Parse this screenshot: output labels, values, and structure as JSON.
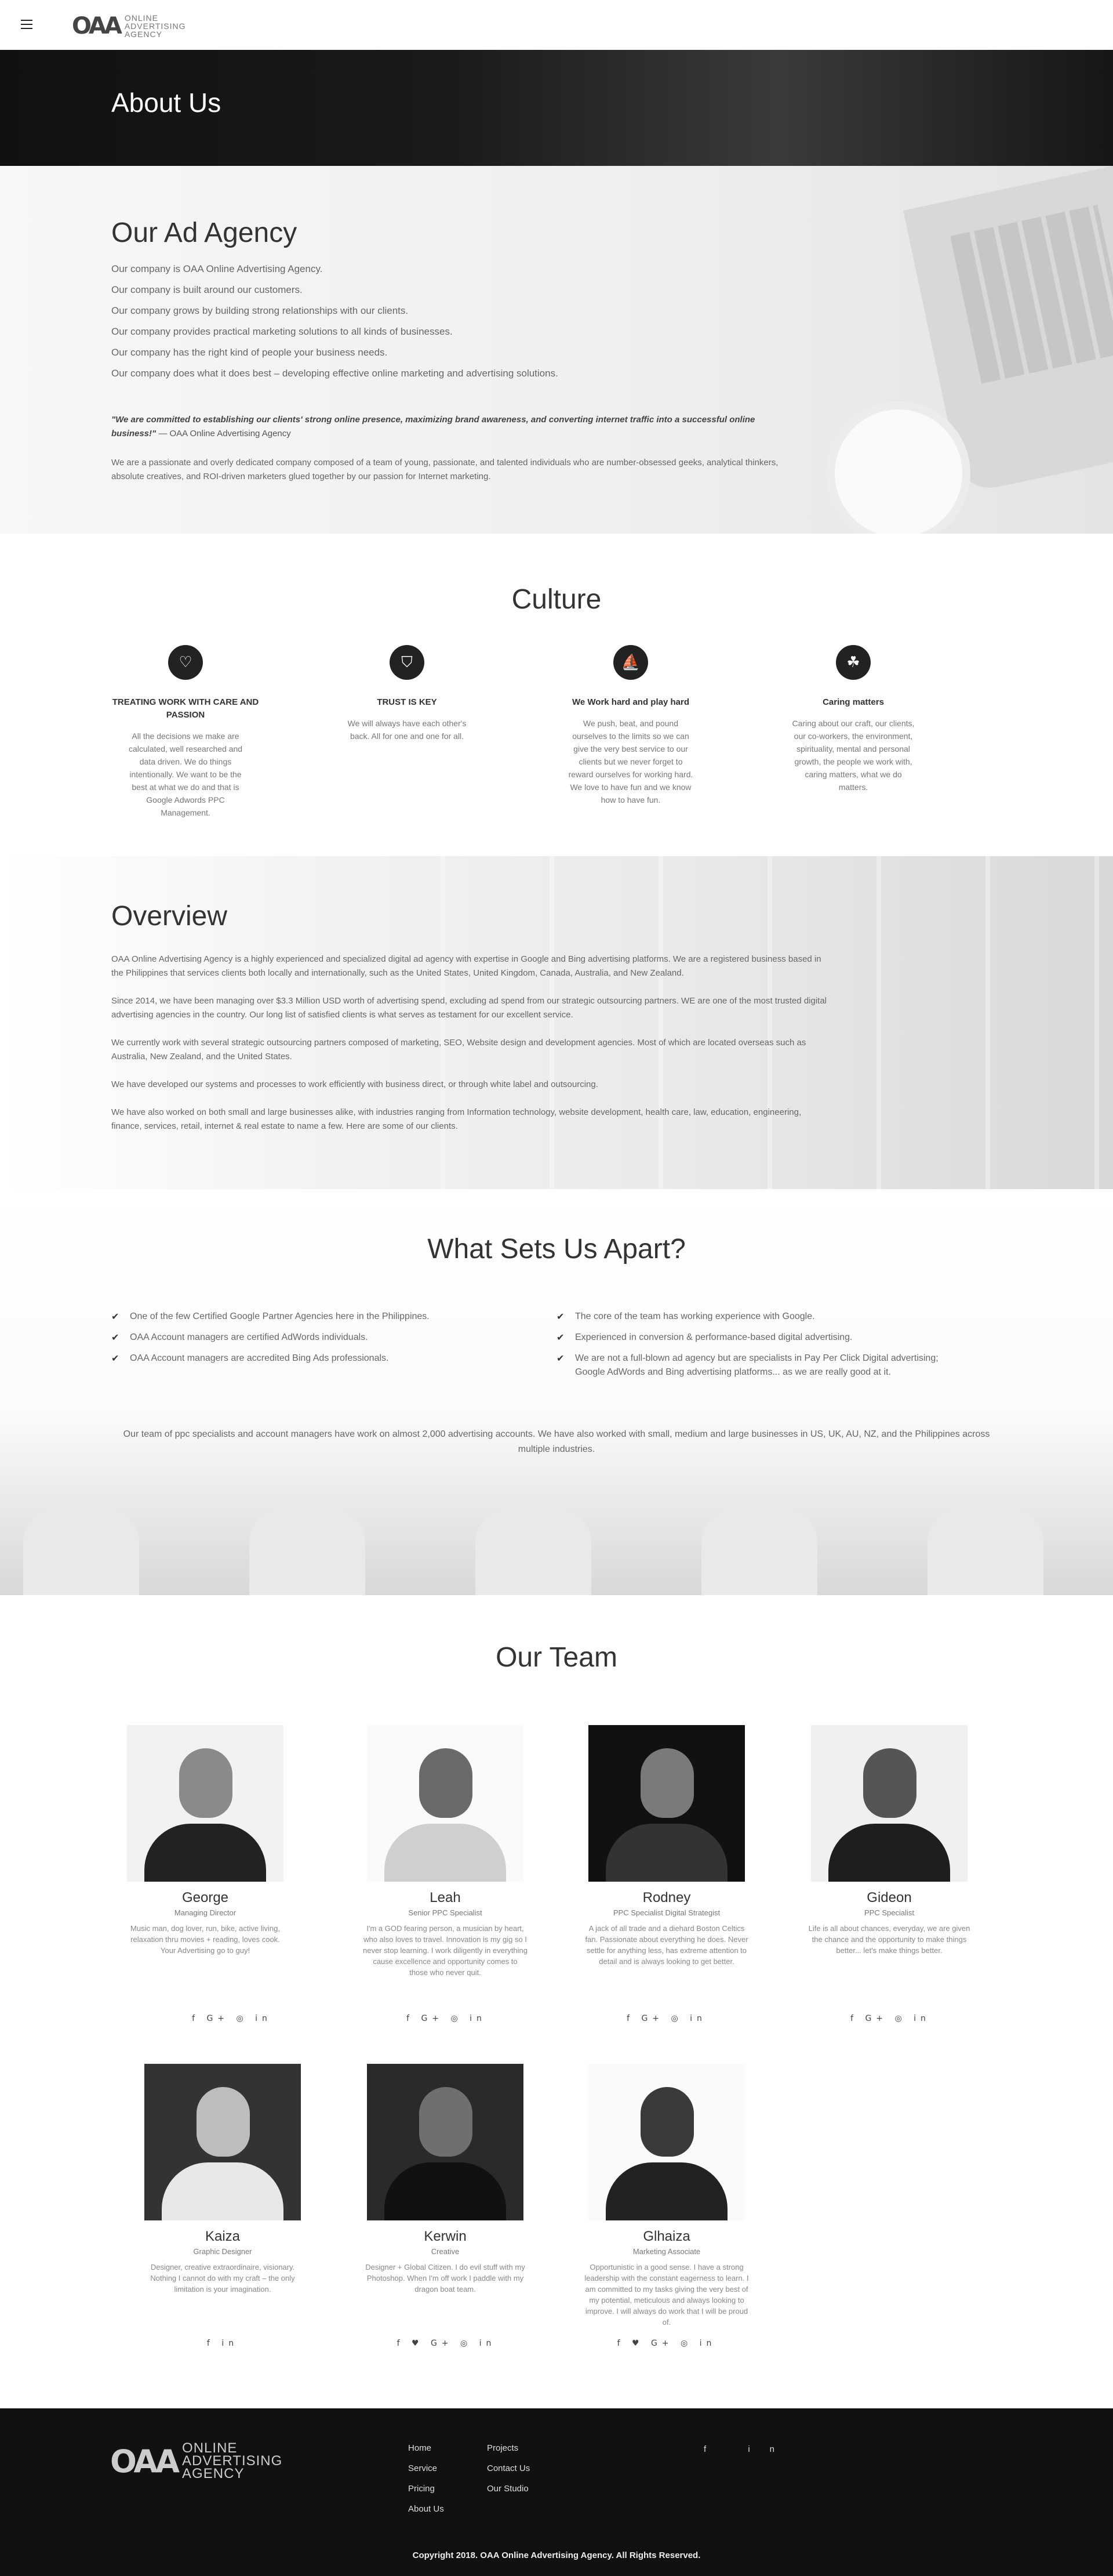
{
  "header": {
    "logo_mark": "OAA",
    "logo_line1": "ONLINE",
    "logo_line2": "ADVERTISING",
    "logo_line3": "AGENCY",
    "menu_icon": "hamburger-icon"
  },
  "hero": {
    "title": "About Us"
  },
  "agency": {
    "title": "Our Ad Agency",
    "lines": [
      "Our company is OAA Online Advertising Agency.",
      "Our company is built around our customers.",
      "Our company grows by building strong relationships with our clients.",
      "Our company provides practical marketing solutions to all kinds of businesses.",
      "Our company has the right kind of people your business needs.",
      "Our company does what it does best – developing effective online marketing and advertising solutions."
    ],
    "quote": "\"We are committed to establishing our clients' strong online presence, maximizing brand awareness, and converting internet traffic into a successful online business!\"",
    "quote_author": "— OAA Online Advertising Agency",
    "paragraph": "We are a passionate and overly dedicated company composed of a team of young, passionate, and talented individuals who are number-obsessed geeks, analytical thinkers, absolute creatives, and ROI-driven marketers glued together by our passion for Internet marketing."
  },
  "culture": {
    "title": "Culture",
    "items": [
      {
        "icon": "heart-icon",
        "title": "TREATING WORK WITH CARE AND PASSION",
        "text": "All the decisions we make are calculated, well researched and data driven. We do things intentionally. We want to be the best at what we do and that is Google Adwords PPC Management."
      },
      {
        "icon": "shield-icon",
        "title": "TRUST IS KEY",
        "text": "We will always have each other's back. All for one and one for all."
      },
      {
        "icon": "boat-icon",
        "title": "We Work hard and play hard",
        "text": "We push, beat, and pound ourselves to the limits so we can give the very best service to our clients but we never forget to reward ourselves for working hard. We love to have fun and we know how to have fun."
      },
      {
        "icon": "handshake-icon",
        "title": "Caring matters",
        "text": "Caring about our craft, our clients, our co-workers, the environment, spirituality, mental and personal growth, the people we work with, caring matters, what we do matters."
      }
    ]
  },
  "overview": {
    "title": "Overview",
    "paragraphs": [
      "OAA Online Advertising Agency is a highly experienced and specialized digital ad agency with expertise in Google and Bing advertising platforms. We are a registered business based in the Philippines that services clients both locally and internationally, such as the United States, United Kingdom, Canada, Australia, and New Zealand.",
      "Since 2014, we have been managing over $3.3 Million USD worth of advertising spend, excluding ad spend from our strategic outsourcing partners. WE are one of the most trusted digital advertising agencies in the country. Our long list of satisfied clients is what serves as testament for our excellent service.",
      "We currently work with several strategic outsourcing partners composed of marketing, SEO, Website design and development agencies. Most of which are located overseas such as Australia, New Zealand, and the United States.",
      "We have developed our systems and processes to work efficiently with business direct, or through white label and outsourcing.",
      "We have also worked on both small and large businesses alike, with industries ranging from Information technology, website development, health care, law, education, engineering, finance, services, retail, internet & real estate to name a few. Here are some of our clients."
    ]
  },
  "apart": {
    "title": "What Sets Us Apart?",
    "left": [
      "One of the few Certified Google Partner Agencies here in the Philippines.",
      "OAA Account managers are certified AdWords individuals.",
      "OAA Account managers are accredited Bing Ads professionals."
    ],
    "right": [
      "The core of the team has working experience with Google.",
      "Experienced in conversion & performance-based digital advertising.",
      "We are not a full-blown ad agency but are specialists in Pay Per Click Digital advertising; Google AdWords and Bing advertising platforms... as we are really good at it."
    ],
    "paragraph": "Our team of ppc specialists and account managers have work on almost 2,000 advertising accounts. We have also worked with small, medium and large businesses in US, UK, AU, NZ, and the Philippines across multiple industries."
  },
  "team": {
    "title": "Our Team",
    "members": [
      {
        "name": "George",
        "role": "Managing Director",
        "bio": "Music man, dog lover, run, bike, active living, relaxation thru movies + reading, loves cook. Your Advertising go to guy!",
        "socials": "f G+ ◎ in"
      },
      {
        "name": "Leah",
        "role": "Senior PPC Specialist",
        "bio": "I'm a GOD fearing person, a musician by heart, who also loves to travel. Innovation is my gig so I never stop learning. I work diligently in everything cause excellence and opportunity comes to those who never quit.",
        "socials": "f G+ ◎ in"
      },
      {
        "name": "Rodney",
        "role": "PPC Specialist Digital Strategist",
        "bio": "A jack of all trade and a diehard Boston Celtics fan. Passionate about everything he does. Never settle for anything less, has extreme attention to detail and is always looking to get better.",
        "socials": "f G+ ◎ in"
      },
      {
        "name": "Gideon",
        "role": "PPC Specialist",
        "bio": "Life is all about chances, everyday, we are given the chance and the opportunity to make things better... let's make things better.",
        "socials": "f G+ ◎ in"
      },
      {
        "name": "Kaiza",
        "role": "Graphic Designer",
        "bio": "Designer, creative extraordinaire, visionary. Nothing I cannot do with my craft – the only limitation is your imagination.",
        "socials": "f in"
      },
      {
        "name": "Kerwin",
        "role": "Creative",
        "bio": "Designer + Global Citizen. I do evil stuff with my Photoshop. When I'm off work I paddle with my dragon boat team.",
        "socials": "f ♥ G+ ◎ in"
      },
      {
        "name": "Glhaiza",
        "role": "Marketing Associate",
        "bio": "Opportunistic in a good sense. I have a strong leadership with the constant eagerness to learn. I am committed to my tasks giving the very best of my potential, meticulous and always looking to improve. I will always do work that I will be proud of.",
        "socials": "f ♥ G+ ◎ in"
      }
    ]
  },
  "footer": {
    "logo_mark": "OAA",
    "logo_line1": "ONLINE",
    "logo_line2": "ADVERTISING",
    "logo_line3": "AGENCY",
    "col1": [
      "Home",
      "Service",
      "Pricing",
      "About Us"
    ],
    "col2": [
      "Projects",
      "Contact Us",
      "Our Studio"
    ],
    "social_facebook": "f",
    "social_linkedin": "in",
    "copyright": "Copyright 2018. OAA Online Advertising Agency. All Rights Reserved."
  },
  "colors": {
    "dark": "#111111",
    "text": "#666666",
    "heading": "#333333"
  }
}
